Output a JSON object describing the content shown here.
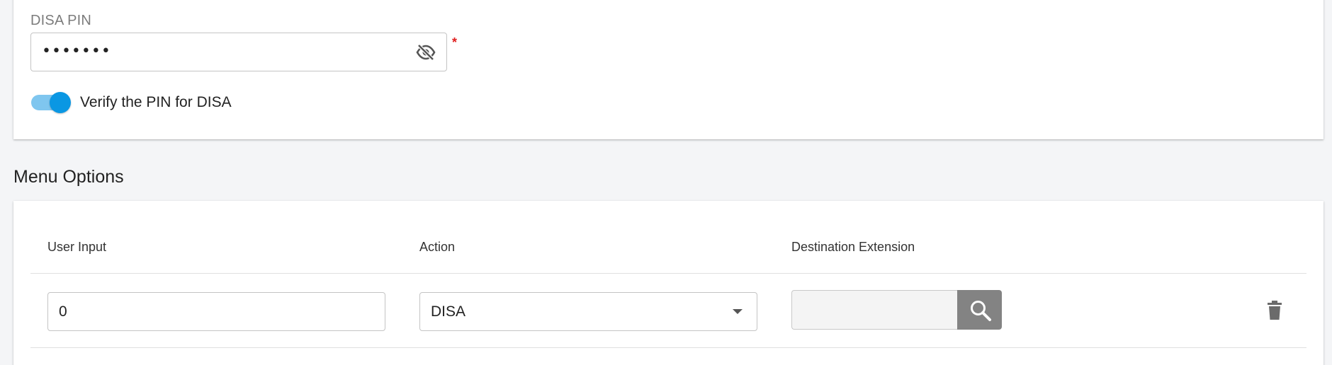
{
  "disa": {
    "pin_label": "DISA PIN",
    "pin_value": "•••••••",
    "required_mark": "*",
    "visibility_icon": "eye-off-icon",
    "verify_toggle": {
      "label": "Verify the PIN for DISA",
      "checked": true
    }
  },
  "menu_options": {
    "title": "Menu Options",
    "columns": [
      "User Input",
      "Action",
      "Destination Extension"
    ],
    "rows": [
      {
        "user_input": "0",
        "action": "DISA",
        "destination": ""
      }
    ],
    "search_icon": "search-icon",
    "delete_icon": "trash-icon"
  },
  "colors": {
    "toggle_active": "#0a97e3",
    "toggle_track": "#7fc6ef",
    "required": "#e02020",
    "search_button": "#838383"
  }
}
